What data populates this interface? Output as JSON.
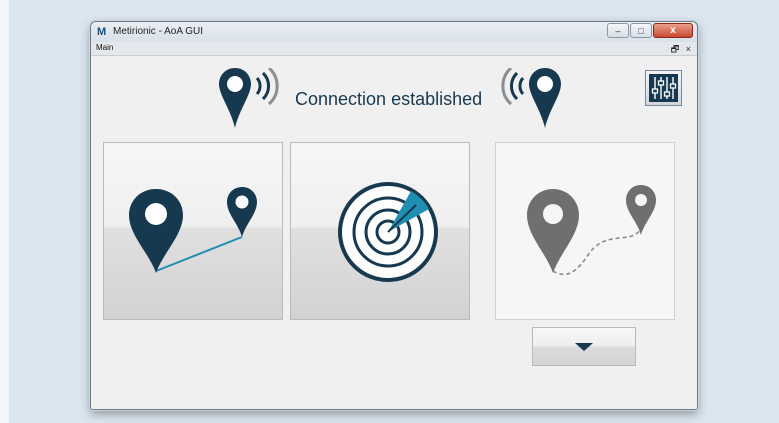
{
  "window": {
    "app_logo": "M",
    "title": "Metirionic - AoA GUI",
    "controls": {
      "minimize": "–",
      "maximize": "□",
      "close": "x"
    }
  },
  "menubar": {
    "main_label": "Main",
    "restore_glyph": "🗗",
    "close_glyph": "×"
  },
  "header": {
    "status_text": "Connection established"
  },
  "icons": {
    "left_pin": "location-broadcast-icon",
    "right_pin": "location-receive-icon",
    "settings": "sliders-icon"
  },
  "tiles": [
    {
      "name": "distance-tile",
      "icon": "two-pins-line-icon",
      "enabled": true
    },
    {
      "name": "radar-tile",
      "icon": "radar-icon",
      "enabled": true
    },
    {
      "name": "path-tile",
      "icon": "two-pins-dashed-path-icon",
      "enabled": false
    }
  ],
  "expand": {
    "icon": "chevron-down-icon"
  },
  "colors": {
    "accent_dark": "#17394f",
    "accent_teal": "#1e8fb0",
    "disabled_grey": "#6f6f6f",
    "backdrop": "#dbe6ef"
  }
}
